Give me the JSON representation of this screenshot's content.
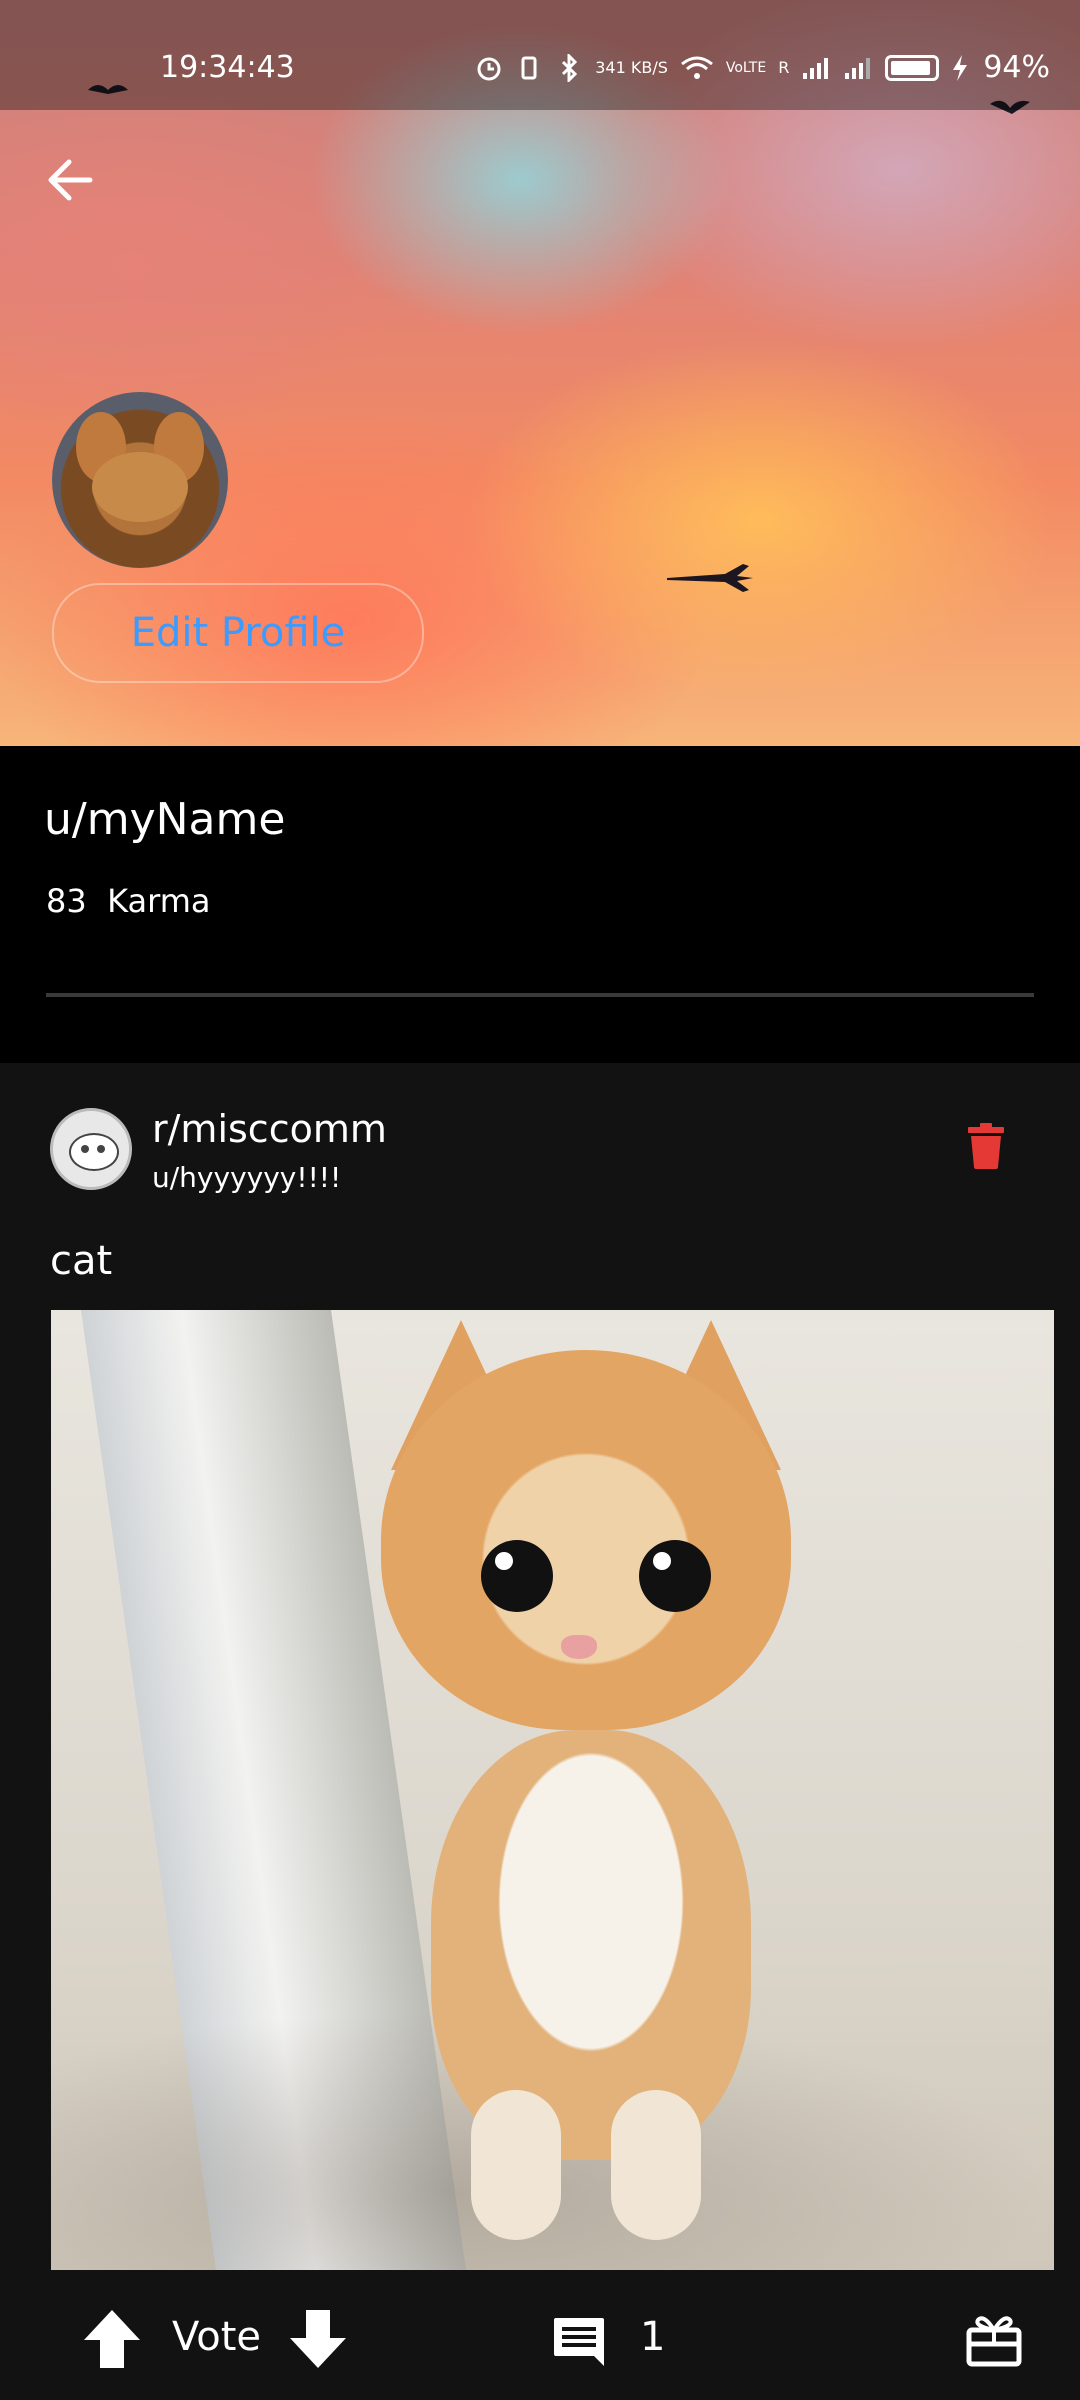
{
  "status_bar": {
    "time": "19:34:43",
    "network_speed": "341 KB/S",
    "volte": "VoLTE",
    "roaming": "R",
    "battery": "94%"
  },
  "profile": {
    "edit_profile_label": "Edit Profile",
    "username": "u/myName",
    "karma_value": "83",
    "karma_label": "Karma"
  },
  "post": {
    "subreddit": "r/misccomm",
    "author": "u/hyyyyyy!!!!",
    "title": "cat",
    "vote_label": "Vote",
    "comment_count": "1"
  },
  "colors": {
    "accent_blue": "#3b9bff",
    "delete_red": "#e53935",
    "card_bg": "#121212"
  }
}
